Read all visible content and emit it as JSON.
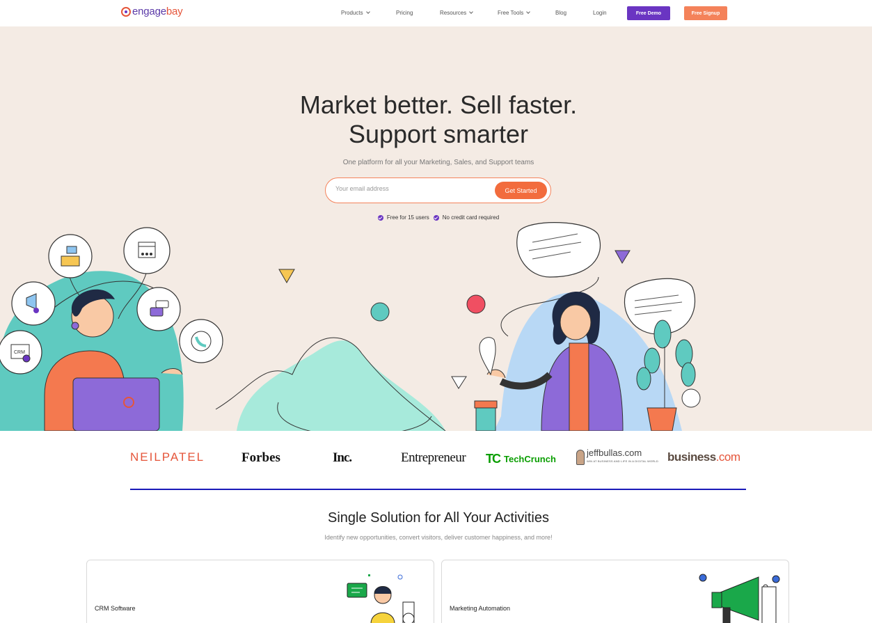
{
  "nav": {
    "logo_part1": "engage",
    "logo_part2": "bay",
    "items": [
      {
        "label": "Products",
        "dropdown": true
      },
      {
        "label": "Pricing",
        "dropdown": false
      },
      {
        "label": "Resources",
        "dropdown": true
      },
      {
        "label": "Free Tools",
        "dropdown": true
      },
      {
        "label": "Blog",
        "dropdown": false
      },
      {
        "label": "Login",
        "dropdown": false
      }
    ],
    "demo_label": "Free Demo",
    "signup_label": "Free Signup"
  },
  "hero": {
    "title_line1": "Market better. Sell faster.",
    "title_line2": "Support smarter",
    "subtitle": "One platform for all your Marketing, Sales, and Support teams",
    "email_placeholder": "Your email address",
    "cta_label": "Get Started",
    "check_1": "Free for 15 users",
    "check_2": "No credit card required",
    "crm_badge": "CRM"
  },
  "logos": {
    "neilpatel": "NEILPATEL",
    "forbes": "Forbes",
    "inc": "Inc.",
    "entrepreneur": "Entrepreneur",
    "techcrunch_mark": "TC",
    "techcrunch_a": "Tech",
    "techcrunch_b": "Crunch",
    "jeffbullas": "jeffbullas.com",
    "jeffbullas_tag": "WIN AT BUSINESS AND LIFE IN A DIGITAL WORLD",
    "business_a": "business",
    "business_b": ".com"
  },
  "solutions": {
    "title": "Single Solution for All Your Activities",
    "subtitle": "Identify new opportunities, convert visitors, deliver customer happiness, and more!",
    "cards": [
      {
        "title": "CRM Software"
      },
      {
        "title": "Marketing Automation"
      }
    ]
  },
  "colors": {
    "purple": "#6a35c2",
    "orange": "#f26c3d",
    "hero_bg": "#f4ebe4",
    "divider": "#1a1ab8"
  }
}
